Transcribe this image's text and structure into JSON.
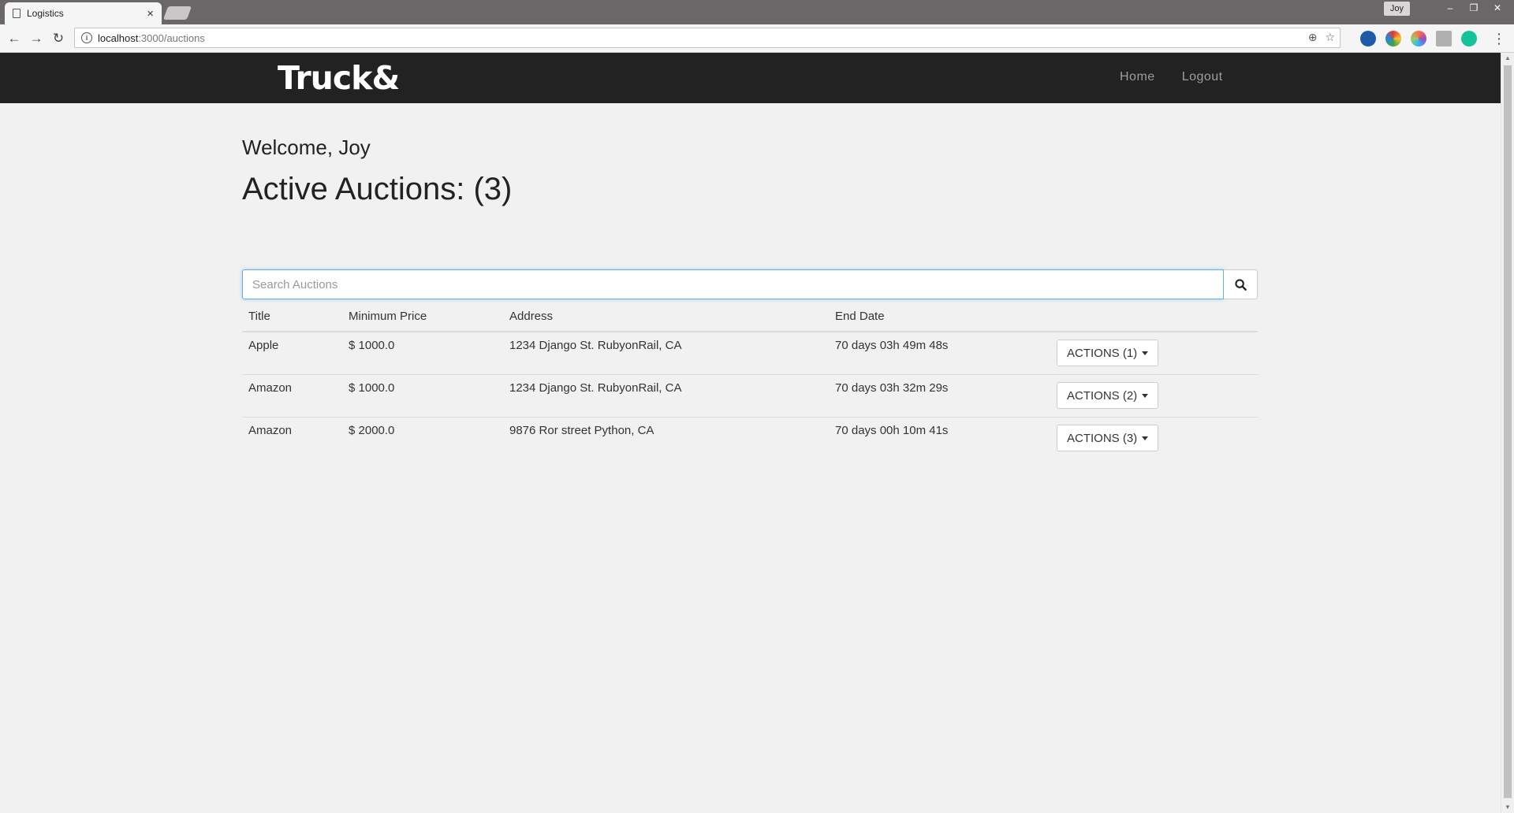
{
  "browser": {
    "tab_title": "Logistics",
    "tab_close": "×",
    "url_host": "localhost",
    "url_path": ":3000/auctions",
    "profile": "Joy",
    "window_controls": [
      "–",
      "❐",
      "✕"
    ]
  },
  "navbar": {
    "brand": "Truck&",
    "links": [
      "Home",
      "Logout"
    ]
  },
  "page": {
    "welcome": "Welcome, Joy",
    "active_title": "Active Auctions: (3)"
  },
  "search": {
    "placeholder": "Search Auctions",
    "value": ""
  },
  "table": {
    "headers": [
      "Title",
      "Minimum Price",
      "Address",
      "End Date"
    ],
    "rows": [
      {
        "title": "Apple",
        "price": "$ 1000.0",
        "address": "1234 Django St. RubyonRail, CA",
        "end": "70 days 03h 49m 48s",
        "action": "ACTIONS (1)"
      },
      {
        "title": "Amazon",
        "price": "$ 1000.0",
        "address": "1234 Django St. RubyonRail, CA",
        "end": "70 days 03h 32m 29s",
        "action": "ACTIONS (2)"
      },
      {
        "title": "Amazon",
        "price": "$ 2000.0",
        "address": "9876 Ror street Python, CA",
        "end": "70 days 00h 10m 41s",
        "action": "ACTIONS (3)"
      }
    ]
  },
  "icons": {
    "search": "search-icon",
    "caret": "caret-down-icon"
  },
  "colors": {
    "navbar_bg": "#222222",
    "nav_link": "#9d9d9d",
    "focus_border": "#66afe9"
  }
}
